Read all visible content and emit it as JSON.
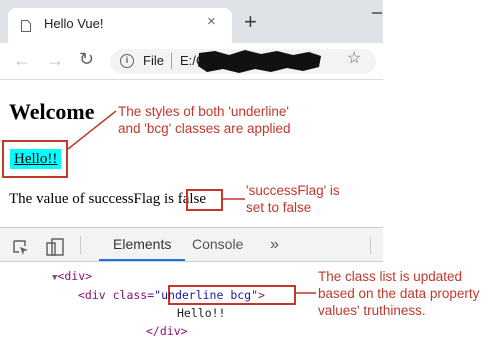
{
  "browser": {
    "tab_title": "Hello Vue!",
    "tab_close": "×",
    "new_tab": "+",
    "nav": {
      "back": "←",
      "forward": "→",
      "reload": "↻",
      "star": "☆"
    },
    "omnibox": {
      "scheme_label": "File",
      "url_visible": "E:/C"
    }
  },
  "page": {
    "heading": "Welcome",
    "hello_text": "Hello!!",
    "value_prefix": "The value of successFlag is",
    "value_text": "false"
  },
  "annotations": {
    "note1_line1": "The styles of both 'underline'",
    "note1_line2": "and 'bcg' classes are applied",
    "note2_line1": "'successFlag' is",
    "note2_line2": "set to false",
    "note3_line1": "The class list is updated",
    "note3_line2": "based on the data property",
    "note3_line3": "values' truthiness."
  },
  "devtools": {
    "tabs": {
      "elements": "Elements",
      "console": "Console",
      "more": "»"
    },
    "dom": {
      "open_div": "<div>",
      "child_tag_start": "<div class=",
      "class_value": "\"underline bcg\"",
      "child_tag_end": ">",
      "text_node": "Hello!!",
      "close_div": "</div>"
    }
  },
  "colors": {
    "annotation_red": "#c0392b",
    "hello_background": "#00ffff",
    "devtools_active_tab": "#1a73e8"
  }
}
